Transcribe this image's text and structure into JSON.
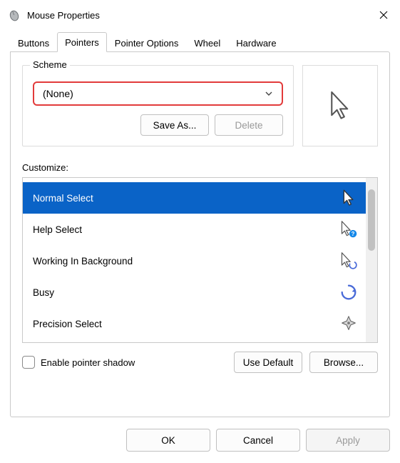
{
  "window": {
    "title": "Mouse Properties"
  },
  "tabs": [
    "Buttons",
    "Pointers",
    "Pointer Options",
    "Wheel",
    "Hardware"
  ],
  "active_tab": "Pointers",
  "scheme": {
    "legend": "Scheme",
    "value": "(None)",
    "save_as_label": "Save As...",
    "delete_label": "Delete",
    "delete_enabled": false
  },
  "customize": {
    "label": "Customize:",
    "items": [
      {
        "name": "Normal Select",
        "icon": "cursor-arrow",
        "selected": true
      },
      {
        "name": "Help Select",
        "icon": "cursor-help",
        "selected": false
      },
      {
        "name": "Working In Background",
        "icon": "cursor-busy-bg",
        "selected": false
      },
      {
        "name": "Busy",
        "icon": "cursor-busy",
        "selected": false
      },
      {
        "name": "Precision Select",
        "icon": "cursor-precision",
        "selected": false
      }
    ]
  },
  "pointer_shadow": {
    "label": "Enable pointer shadow",
    "checked": false
  },
  "use_default_label": "Use Default",
  "browse_label": "Browse...",
  "dialog_buttons": {
    "ok": "OK",
    "cancel": "Cancel",
    "apply": "Apply",
    "apply_enabled": false
  }
}
